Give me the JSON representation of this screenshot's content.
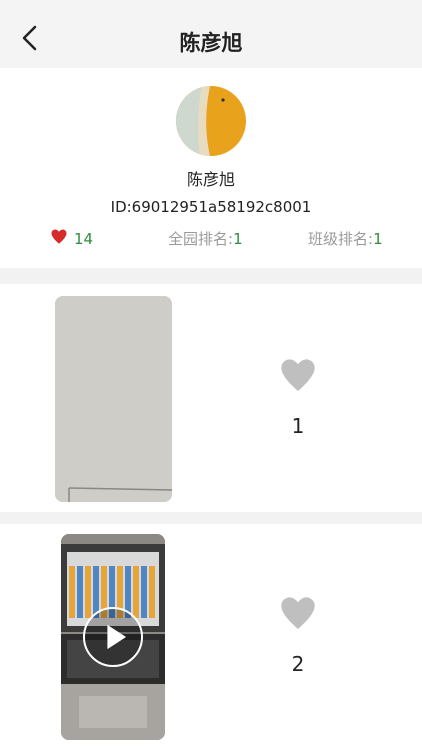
{
  "header": {
    "title": "陈彦旭"
  },
  "profile": {
    "name": "陈彦旭",
    "id_text": "ID:69012951a58192c8001",
    "likes": "14",
    "rank_school_label": "全园排名:",
    "rank_school_value": "1",
    "rank_class_label": "班级排名:",
    "rank_class_value": "1"
  },
  "posts": [
    {
      "likes": "1",
      "type": "photo"
    },
    {
      "likes": "2",
      "type": "video"
    }
  ],
  "colors": {
    "accent_green": "#2f8e3d",
    "heart_red": "#d62b2b",
    "heart_gray": "#bfbfbf"
  }
}
